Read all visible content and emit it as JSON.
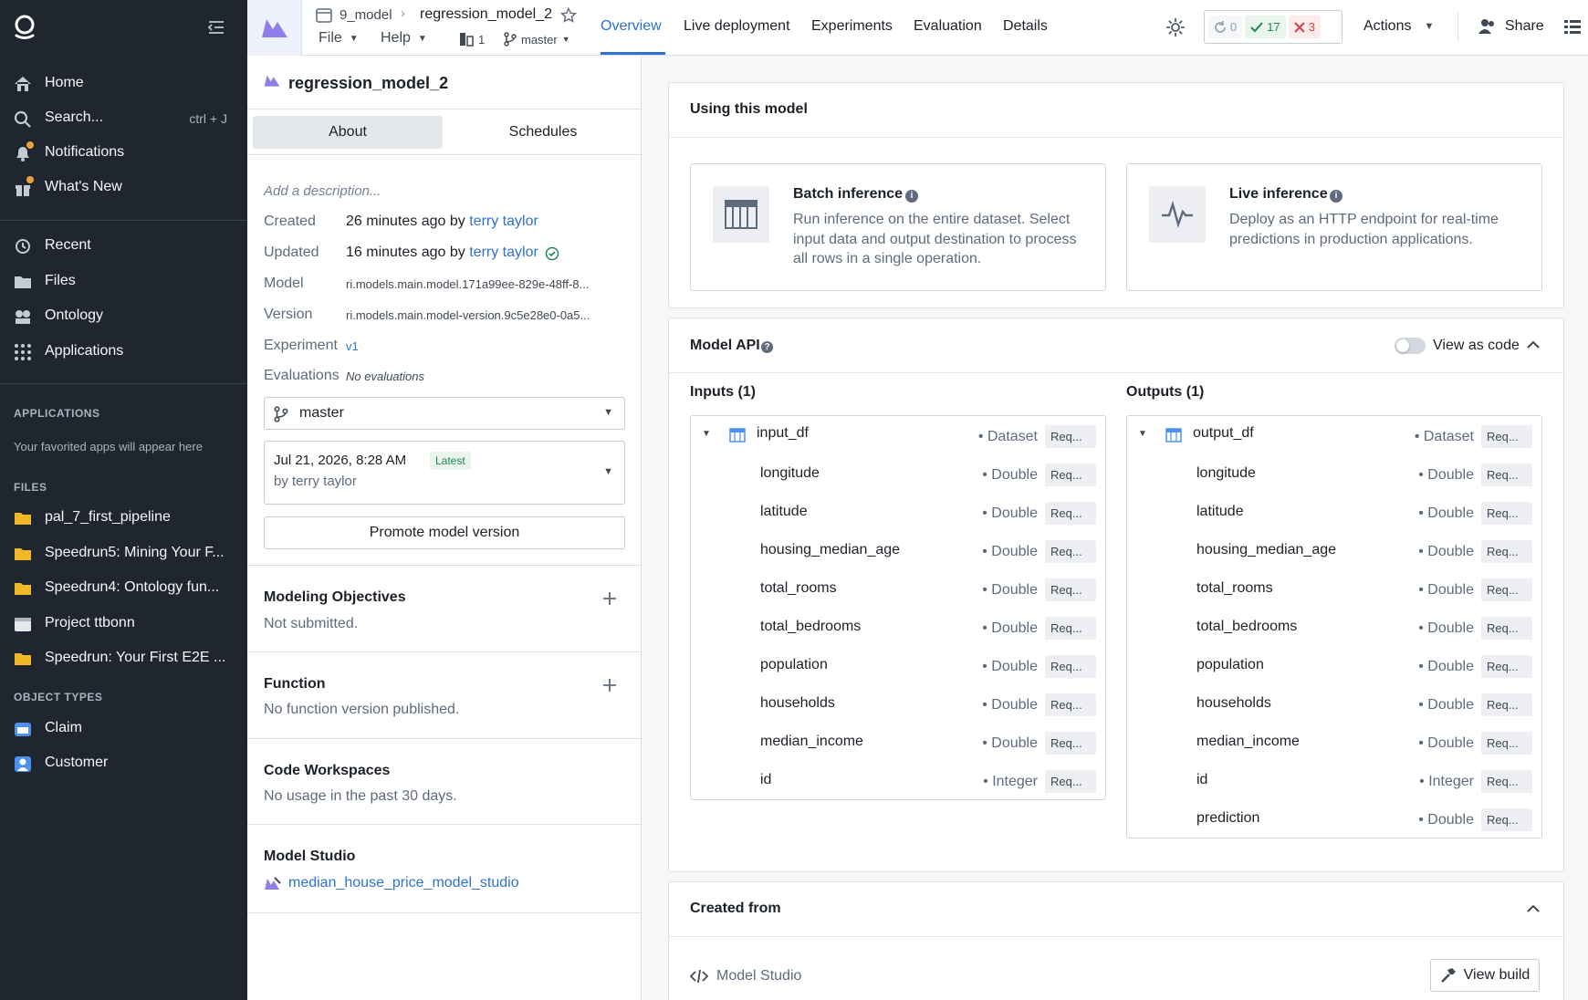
{
  "nav": {
    "items": [
      {
        "label": "Home",
        "icon": "home-icon"
      },
      {
        "label": "Search...",
        "icon": "search-icon",
        "shortcut": "ctrl + J"
      },
      {
        "label": "Notifications",
        "icon": "bell-icon"
      },
      {
        "label": "What's New",
        "icon": "gift-icon"
      },
      {
        "label": "Recent",
        "icon": "history-icon"
      },
      {
        "label": "Files",
        "icon": "folder-icon"
      },
      {
        "label": "Ontology",
        "icon": "cube-icon"
      },
      {
        "label": "Applications",
        "icon": "grid-icon"
      }
    ],
    "applications_title": "APPLICATIONS",
    "applications_note": "Your favorited apps will appear here",
    "files_title": "FILES",
    "files": [
      {
        "label": "pal_7_first_pipeline",
        "icon": "folder-icon"
      },
      {
        "label": "Speedrun5: Mining Your F...",
        "icon": "folder-icon"
      },
      {
        "label": "Speedrun4: Ontology fun...",
        "icon": "folder-icon"
      },
      {
        "label": "Project ttbonn",
        "icon": "project-icon"
      },
      {
        "label": "Speedrun: Your First E2E ...",
        "icon": "folder-icon"
      }
    ],
    "object_types_title": "OBJECT TYPES",
    "object_types": [
      {
        "label": "Claim",
        "icon": "folder-blue-icon"
      },
      {
        "label": "Customer",
        "icon": "person-icon"
      }
    ]
  },
  "topbar": {
    "breadcrumb_parent": "9_model",
    "breadcrumb_current": "regression_model_2",
    "menu_file": "File",
    "menu_help": "Help",
    "count": "1",
    "branch": "master",
    "tabs": [
      "Overview",
      "Live deployment",
      "Experiments",
      "Evaluation",
      "Details"
    ],
    "status": {
      "pending": "0",
      "success": "17",
      "failed": "3"
    },
    "actions_label": "Actions",
    "share_label": "Share",
    "colors": {
      "accent": "#2d72d2",
      "success": "#238551",
      "danger": "#cd4246"
    }
  },
  "side": {
    "title": "regression_model_2",
    "tab_about": "About",
    "tab_schedules": "Schedules",
    "description_placeholder": "Add a description...",
    "created_label": "Created",
    "created_value": "26 minutes ago",
    "created_by_prefix": "by",
    "created_by": "terry taylor",
    "updated_label": "Updated",
    "updated_value": "16 minutes ago",
    "updated_by_prefix": "by",
    "updated_by": "terry taylor",
    "model_label": "Model",
    "model_value": "ri.models.main.model.171a99ee-829e-48ff-8...",
    "version_label": "Version",
    "version_value": "ri.models.main.model-version.9c5e28e0-0a5...",
    "experiment_label": "Experiment",
    "experiment_value": "v1",
    "evaluations_label": "Evaluations",
    "evaluations_value": "No evaluations",
    "branch_select": "master",
    "version_date": "Jul 21, 2026, 8:28 AM",
    "version_badge": "Latest",
    "version_author": "by terry taylor",
    "promote_label": "Promote model version",
    "objectives_title": "Modeling Objectives",
    "objectives_sub": "Not submitted.",
    "function_title": "Function",
    "function_sub": "No function version published.",
    "workspaces_title": "Code Workspaces",
    "workspaces_sub": "No usage in the past 30 days.",
    "studio_title": "Model Studio",
    "studio_link": "median_house_price_model_studio"
  },
  "main": {
    "using_title": "Using this model",
    "batch_title": "Batch inference",
    "batch_desc": "Run inference on the entire dataset. Select input data and output destination to process all rows in a single operation.",
    "live_title": "Live inference",
    "live_desc": "Deploy as an HTTP endpoint for real-time predictions in production applications.",
    "api_title": "Model API",
    "view_as_code": "View as code",
    "inputs_title": "Inputs (1)",
    "outputs_title": "Outputs (1)",
    "input_name": "input_df",
    "input_type": "Dataset",
    "output_name": "output_df",
    "output_type": "Dataset",
    "req_label": "Req...",
    "input_fields": [
      {
        "name": "longitude",
        "type": "Double"
      },
      {
        "name": "latitude",
        "type": "Double"
      },
      {
        "name": "housing_median_age",
        "type": "Double"
      },
      {
        "name": "total_rooms",
        "type": "Double"
      },
      {
        "name": "total_bedrooms",
        "type": "Double"
      },
      {
        "name": "population",
        "type": "Double"
      },
      {
        "name": "households",
        "type": "Double"
      },
      {
        "name": "median_income",
        "type": "Double"
      },
      {
        "name": "id",
        "type": "Integer"
      }
    ],
    "output_fields": [
      {
        "name": "longitude",
        "type": "Double"
      },
      {
        "name": "latitude",
        "type": "Double"
      },
      {
        "name": "housing_median_age",
        "type": "Double"
      },
      {
        "name": "total_rooms",
        "type": "Double"
      },
      {
        "name": "total_bedrooms",
        "type": "Double"
      },
      {
        "name": "population",
        "type": "Double"
      },
      {
        "name": "households",
        "type": "Double"
      },
      {
        "name": "median_income",
        "type": "Double"
      },
      {
        "name": "id",
        "type": "Integer"
      },
      {
        "name": "prediction",
        "type": "Double"
      }
    ],
    "created_from_title": "Created from",
    "created_from_source": "Model Studio",
    "view_build_label": "View build"
  }
}
